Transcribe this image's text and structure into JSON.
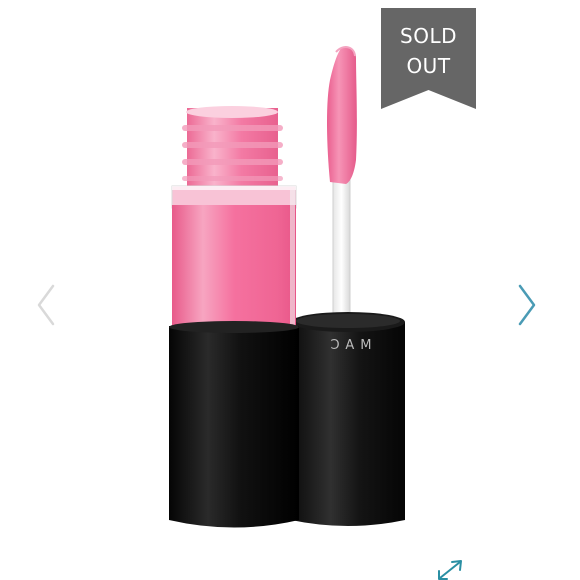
{
  "product": {
    "brand_mark": "MAC",
    "shade_color": "#f5719f",
    "cap_color": "#111111"
  },
  "badge": {
    "line1": "SOLD",
    "line2": "OUT",
    "color": "#666666"
  },
  "navigation": {
    "prev_icon": "chevron-left-icon",
    "next_icon": "chevron-right-icon",
    "prev_color": "#d9d9d9",
    "next_color": "#4a9bb5"
  },
  "expand": {
    "icon": "expand-arrow-icon",
    "color": "#2a8fa3"
  }
}
